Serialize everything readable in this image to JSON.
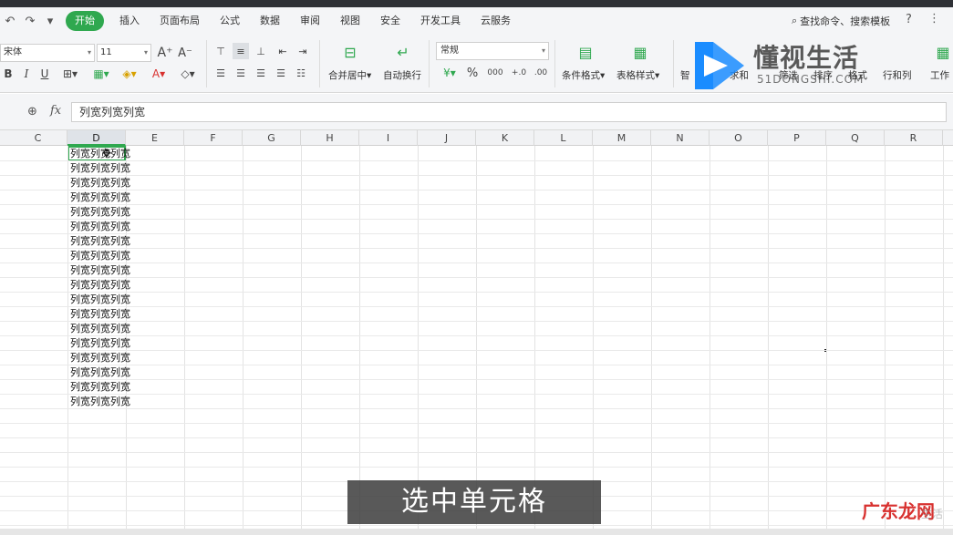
{
  "menubar": {
    "tabs": [
      "开始",
      "插入",
      "页面布局",
      "公式",
      "数据",
      "审阅",
      "视图",
      "安全",
      "开发工具",
      "云服务"
    ],
    "search_label": "查找命令、搜索模板",
    "help_label": "?",
    "more_label": "⋮"
  },
  "ribbon": {
    "font_name": "宋体",
    "font_size": "11",
    "number_format": "常规",
    "merge_label": "合并居中",
    "wrap_label": "自动换行",
    "cond_format_label": "条件格式",
    "table_style_label": "表格样式",
    "partial_labels": [
      "智",
      "求和",
      "筛选",
      "排序",
      "格式",
      "行和列",
      "工作"
    ]
  },
  "watermark": {
    "text": "懂视生活",
    "sub": "51DONGSHI.COM"
  },
  "formula_bar": {
    "fx": "fx",
    "value": "列宽列宽列宽"
  },
  "columns": [
    "C",
    "D",
    "E",
    "F",
    "G",
    "H",
    "I",
    "J",
    "K",
    "L",
    "M",
    "N",
    "O",
    "P",
    "Q",
    "R"
  ],
  "selected_column": "D",
  "cells": [
    "列宽列宽列宽",
    "列宽列宽列宽",
    "列宽列宽列宽",
    "列宽列宽列宽",
    "列宽列宽列宽",
    "列宽列宽列宽",
    "列宽列宽列宽",
    "列宽列宽列宽",
    "列宽列宽列宽",
    "列宽列宽列宽",
    "列宽列宽列宽",
    "列宽列宽列宽",
    "列宽列宽列宽",
    "列宽列宽列宽",
    "列宽列宽列宽",
    "列宽列宽列宽",
    "列宽列宽列宽",
    "列宽列宽列宽"
  ],
  "subtitle": "选中单元格",
  "corner_watermark": "广东龙网",
  "corner_watermark_faint": "生活",
  "colors": {
    "accent": "#2fa84f",
    "ribbon_bg": "#f4f5f7",
    "watermark_blue": "#1a8cff"
  }
}
